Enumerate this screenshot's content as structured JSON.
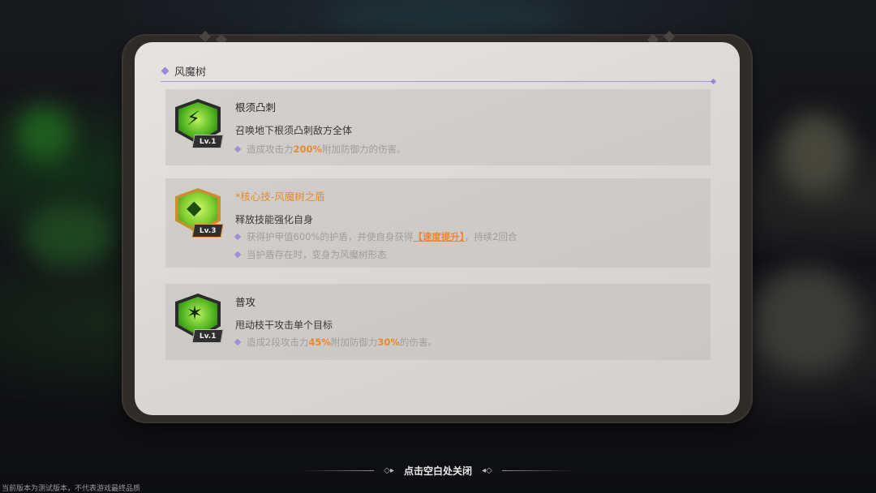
{
  "panel": {
    "title": "风魔树"
  },
  "skills": [
    {
      "name": "根须凸刺",
      "level": "Lv.1",
      "description": "召唤地下根须凸刺敌方全体",
      "details": [
        {
          "pre": "造成攻击力",
          "hl": "200%",
          "post": "附加防御力的伤害。"
        }
      ]
    },
    {
      "name": "*核心技-风魔树之盾",
      "level": "Lv.3",
      "description": "释放技能强化自身",
      "details": [
        {
          "pre": "获得护甲值600%的护盾，并使自身获得",
          "kw": "【速度提升】",
          "post": "，持续2回合"
        },
        {
          "pre": "当护盾存在时，变身为风魔树形态"
        }
      ]
    },
    {
      "name": "普攻",
      "level": "Lv.1",
      "description": "甩动枝干攻击单个目标",
      "details": [
        {
          "pre": "造成2段攻击力",
          "hl": "45%",
          "mid": "附加防御力",
          "hl2": "30%",
          "post": "的伤害。"
        }
      ]
    }
  ],
  "footer": {
    "close_hint": "点击空白处关闭",
    "disclaimer": "当前版本为测试版本，不代表游戏最终品质"
  },
  "colors": {
    "accent_orange": "#e98a2a",
    "accent_purple": "#9b86d3"
  },
  "icons": [
    "root-spike-icon",
    "core-shield-icon",
    "branch-attack-icon"
  ]
}
